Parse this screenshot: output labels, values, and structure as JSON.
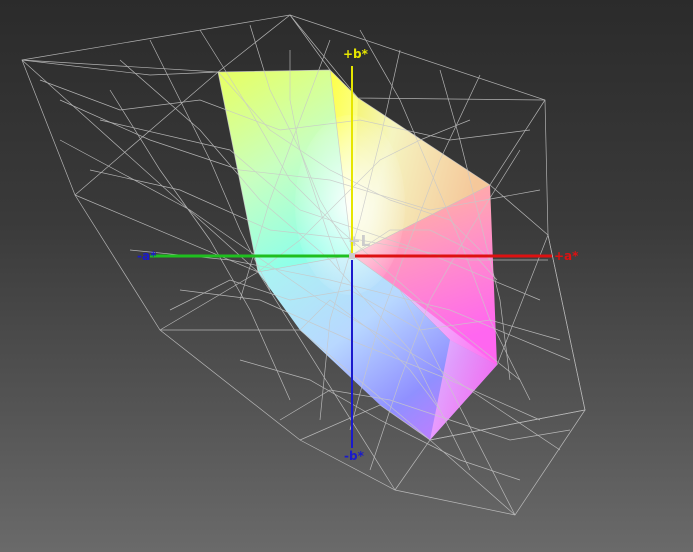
{
  "viewer": {
    "background_top": "#2b2b2b",
    "background_bottom": "#6a6a6a",
    "wireframe_color": "#c8c8c8"
  },
  "axes": {
    "plus_b": {
      "label": "+b*",
      "color": "#e6e600"
    },
    "minus_b": {
      "label": "-b*",
      "color": "#1a1acc"
    },
    "plus_a": {
      "label": "+a*",
      "color": "#dd1111"
    },
    "minus_a": {
      "label": "-a*",
      "color": "#1a1acc"
    },
    "plus_l": {
      "label": "+L",
      "color": "#cccccc"
    }
  },
  "gamut_solid": {
    "vertex_colors": [
      "#ffff55",
      "#ffffff",
      "#ffb0b0",
      "#ff66ee",
      "#c080ff",
      "#8080ff",
      "#80ffff",
      "#aaffaa"
    ]
  }
}
